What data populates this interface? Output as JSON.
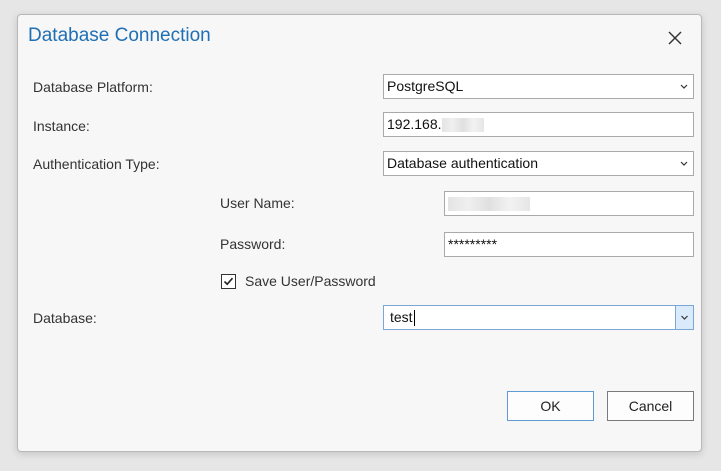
{
  "dialog": {
    "title": "Database Connection"
  },
  "icons": {
    "close": "close-icon",
    "dropdown": "chevron-down-icon",
    "check": "checkmark-icon"
  },
  "colors": {
    "title": "#1f6fb5",
    "focus_border": "#7aa7d6",
    "dropdown_highlight": "#d9ebfa"
  },
  "form": {
    "platform": {
      "label": "Database Platform:",
      "value": "PostgreSQL"
    },
    "instance": {
      "label": "Instance:",
      "value": "192.168."
    },
    "auth_type": {
      "label": "Authentication Type:",
      "value": "Database authentication"
    },
    "username": {
      "label": "User Name:",
      "value": ""
    },
    "password": {
      "label": "Password:",
      "value": "*********"
    },
    "save_credentials": {
      "label": "Save User/Password",
      "checked": true
    },
    "database": {
      "label": "Database:",
      "value": "test"
    }
  },
  "buttons": {
    "ok": "OK",
    "cancel": "Cancel"
  }
}
